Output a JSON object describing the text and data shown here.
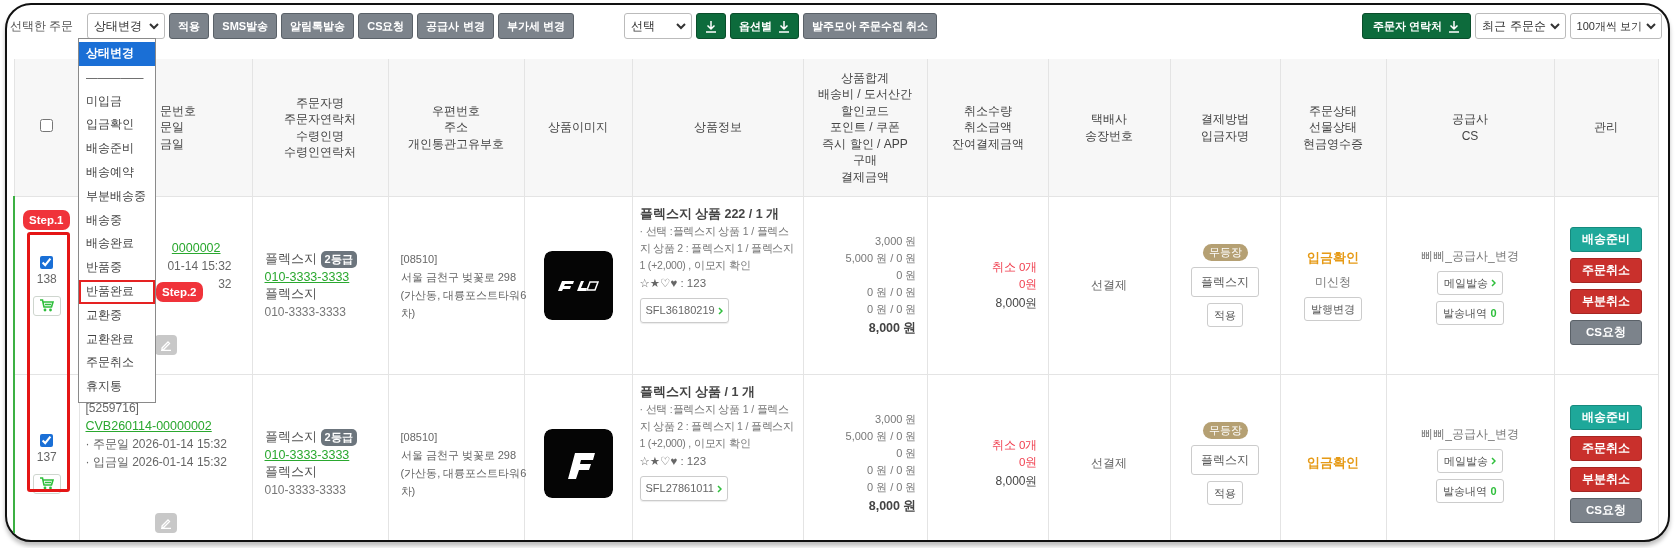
{
  "toolbar": {
    "label": "선택한 주문",
    "status_select": "상태변경",
    "actions": [
      "적용",
      "SMS발송",
      "알림톡발송",
      "CS요청",
      "공급사 변경",
      "부가세 변경"
    ],
    "option_select": "선택",
    "option_download": "옵션별",
    "collect_cancel": "발주모아 주문수집 취소",
    "contact_download": "주문자 연락처",
    "sort_select": "최근 주문순",
    "page_size_select": "100개씩 보기"
  },
  "status_menu": [
    {
      "label": "상태변경",
      "selected": true,
      "outlined": false
    },
    {
      "label": "—————",
      "selected": false,
      "outlined": false
    },
    {
      "label": "미입금",
      "selected": false,
      "outlined": false
    },
    {
      "label": "입금확인",
      "selected": false,
      "outlined": false
    },
    {
      "label": "배송준비",
      "selected": false,
      "outlined": false
    },
    {
      "label": "배송예약",
      "selected": false,
      "outlined": false
    },
    {
      "label": "부분배송중",
      "selected": false,
      "outlined": false
    },
    {
      "label": "배송중",
      "selected": false,
      "outlined": false
    },
    {
      "label": "배송완료",
      "selected": false,
      "outlined": false
    },
    {
      "label": "반품중",
      "selected": false,
      "outlined": false
    },
    {
      "label": "반품완료",
      "selected": false,
      "outlined": true
    },
    {
      "label": "교환중",
      "selected": false,
      "outlined": false
    },
    {
      "label": "교환완료",
      "selected": false,
      "outlined": false
    },
    {
      "label": "주문취소",
      "selected": false,
      "outlined": false
    },
    {
      "label": "휴지통",
      "selected": false,
      "outlined": false
    }
  ],
  "steps": [
    {
      "label": "Step.1",
      "kind": "column"
    },
    {
      "label": "Step.2",
      "kind": "item"
    }
  ],
  "table": {
    "columns": [
      {
        "kind": "checkbox",
        "checked": false
      },
      {
        "kind": "text",
        "partial": true,
        "lines": [
          "문번호",
          "문일",
          "금일"
        ]
      },
      {
        "kind": "text",
        "partial": false,
        "lines": [
          "주문자명",
          "주문자연락처",
          "수령인명",
          "수령인연락처"
        ]
      },
      {
        "kind": "text",
        "partial": false,
        "lines": [
          "우편번호",
          "주소",
          "개인통관고유부호"
        ]
      },
      {
        "kind": "text",
        "partial": false,
        "lines": [
          "상품이미지"
        ]
      },
      {
        "kind": "text",
        "partial": false,
        "lines": [
          "상품정보"
        ]
      },
      {
        "kind": "text",
        "partial": false,
        "lines": [
          "상품합계",
          "배송비 / 도서산간",
          "할인코드",
          "포인트 / 쿠폰",
          "즉시 할인 / APP",
          "구매",
          "결제금액"
        ]
      },
      {
        "kind": "text",
        "partial": false,
        "lines": [
          "취소수량",
          "취소금액",
          "잔여결제금액"
        ]
      },
      {
        "kind": "text",
        "partial": false,
        "lines": [
          "택배사",
          "송장번호"
        ]
      },
      {
        "kind": "text",
        "partial": false,
        "lines": [
          "결제방법",
          "입금자명"
        ]
      },
      {
        "kind": "text",
        "partial": false,
        "lines": [
          "주문상태",
          "선물상태",
          "현금영수증"
        ]
      },
      {
        "kind": "text",
        "partial": false,
        "lines": [
          "공급사",
          "CS"
        ]
      },
      {
        "kind": "text",
        "partial": false,
        "lines": [
          "관리"
        ]
      }
    ],
    "rows": [
      {
        "checked": true,
        "number": "138",
        "order": {
          "partial": true,
          "lines": [
            {
              "kind": "link",
              "text": "0000002"
            },
            {
              "kind": "text",
              "text": "01-14 15:32"
            },
            {
              "kind": "text",
              "text": "32"
            }
          ]
        },
        "orderer": {
          "name": "플렉스지",
          "grade": "2등급",
          "phone": "010-3333-3333",
          "receiver": "플렉스지",
          "receiver_phone": "010-3333-3333"
        },
        "address": {
          "zip": "[08510]",
          "lines": [
            "서울 금천구 벚꽃로 298",
            "(가산동, 대륭포스트타워6",
            "차)"
          ]
        },
        "image": {
          "kind": "picture"
        },
        "product": {
          "title": "플렉스지 상품 222 / 1 개",
          "option": "· 선택 :플렉스지 상품 1 / 플렉스지 상품 2 : 플렉스지 1 / 플렉스지 1 (+2,000) , 이모지 확인",
          "emoji": "☆★♡♥ : 123",
          "code": "SFL36180219"
        },
        "totals": [
          "3,000 원",
          "5,000 원 / 0 원",
          "0 원",
          "0 원 / 0 원",
          "0 원 / 0 원"
        ],
        "total": "8,000 원",
        "cancel": {
          "quantity": "취소 0개",
          "amount": "0원",
          "remaining": "8,000원"
        },
        "courier": "선결제",
        "payment": {
          "badge": "무등장",
          "payer": "플렉스지",
          "apply": "적용"
        },
        "status": {
          "order": "입금확인",
          "gift": "미신청",
          "receipt": "발행변경"
        },
        "supplier": {
          "name": "삐삐_공급사_변경",
          "mail": "메일발송",
          "history": "발송내역",
          "history_count": "0"
        },
        "actions": [
          {
            "label": "배송준비",
            "kind": "teal"
          },
          {
            "label": "주문취소",
            "kind": "danger"
          },
          {
            "label": "부분취소",
            "kind": "danger"
          },
          {
            "label": "CS요청",
            "kind": "secondary"
          }
        ]
      },
      {
        "checked": true,
        "number": "137",
        "order": {
          "partial": false,
          "lines": [
            {
              "kind": "text",
              "text": "[5259716]"
            },
            {
              "kind": "link",
              "text": "CVB260114-00000002"
            },
            {
              "kind": "text",
              "text": "· 주문일 2026-01-14 15:32"
            },
            {
              "kind": "text",
              "text": "· 입금일 2026-01-14 15:32"
            }
          ]
        },
        "orderer": {
          "name": "플렉스지",
          "grade": "2등급",
          "phone": "010-3333-3333",
          "receiver": "플렉스지",
          "receiver_phone": "010-3333-3333"
        },
        "address": {
          "zip": "[08510]",
          "lines": [
            "서울 금천구 벚꽃로 298",
            "(가산동, 대륭포스트타워6",
            "차)"
          ]
        },
        "image": {
          "kind": "picture"
        },
        "product": {
          "title": "플렉스지 상품 / 1 개",
          "option": "· 선택 :플렉스지 상품 1 / 플렉스지 상품 2 : 플렉스지 1 / 플렉스지 1 (+2,000) , 이모지 확인",
          "emoji": "☆★♡♥ : 123",
          "code": "SFL27861011"
        },
        "totals": [
          "3,000 원",
          "5,000 원 / 0 원",
          "0 원",
          "0 원 / 0 원",
          "0 원 / 0 원"
        ],
        "total": "8,000 원",
        "cancel": {
          "quantity": "취소 0개",
          "amount": "0원",
          "remaining": "8,000원"
        },
        "courier": "선결제",
        "payment": {
          "badge": "무등장",
          "payer": "플렉스지",
          "apply": "적용"
        },
        "status": {
          "order": "입금확인"
        },
        "supplier": {
          "name": "삐삐_공급사_변경",
          "mail": "메일발송",
          "history": "발송내역",
          "history_count": "0"
        },
        "actions": [
          {
            "label": "배송준비",
            "kind": "teal"
          },
          {
            "label": "주문취소",
            "kind": "danger"
          },
          {
            "label": "부분취소",
            "kind": "danger"
          },
          {
            "label": "CS요청",
            "kind": "secondary"
          }
        ]
      }
    ]
  }
}
